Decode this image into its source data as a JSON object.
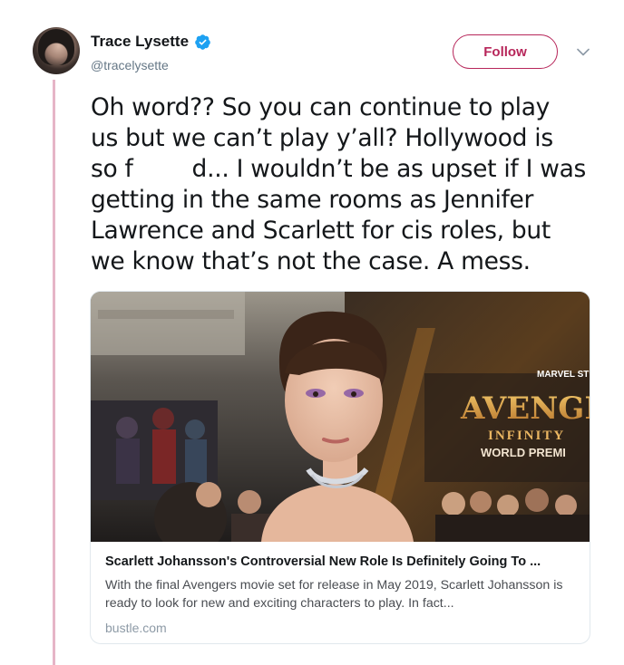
{
  "user": {
    "display_name": "Trace Lysette",
    "handle": "@tracelysette",
    "verified": true
  },
  "actions": {
    "follow_label": "Follow",
    "menu_icon": "chevron-down-icon"
  },
  "tweet": {
    "text": "Oh word?? So you can continue to play\nus but we can’t play y’all? Hollywood is\nso f        d... I wouldn’t be as upset if I was\ngetting in the same rooms as Jennifer\nLawrence and Scarlett for cis roles, but\nwe know that’s not the case. A mess."
  },
  "card": {
    "image_text": {
      "studio": "MARVEL STUDIOS",
      "title": "AVENGERS",
      "subtitle": "INFINITY",
      "premiere": "WORLD PREMI"
    },
    "title": "Scarlett Johansson's Controversial New Role Is Definitely Going To ...",
    "description": "With the final Avengers movie set for release in May 2019, Scarlett Johansson is ready to look for new and exciting characters to play. In fact...",
    "domain": "bustle.com"
  },
  "colors": {
    "accent": "#b7265a",
    "verified": "#1da1f2",
    "thread_line": "#e6b5c7"
  }
}
